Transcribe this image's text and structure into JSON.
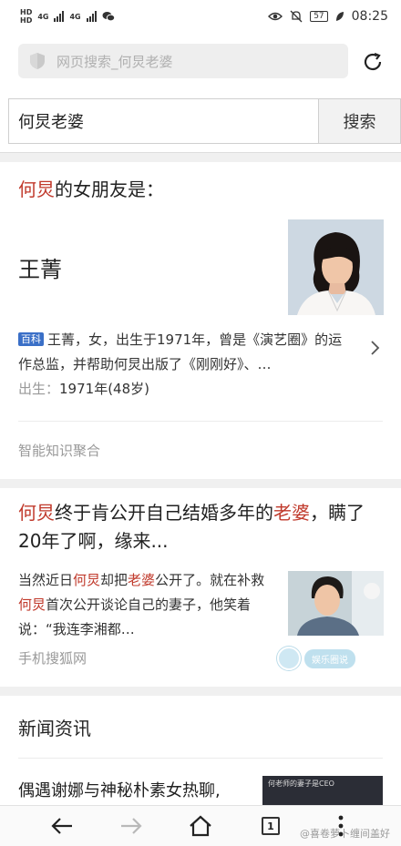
{
  "status_bar": {
    "left_badges": [
      "HD",
      "HD"
    ],
    "network": "4G",
    "battery": "57",
    "time": "08:25"
  },
  "address_bar": {
    "placeholder": "网页搜索_何炅老婆"
  },
  "search": {
    "query": "何炅老婆",
    "button_label": "搜索"
  },
  "knowledge_card": {
    "title_keyword": "何炅",
    "title_rest": "的女朋友是：",
    "name": "王菁",
    "source_tag": "百科",
    "description": "王菁，女，出生于1971年，曾是《演艺圈》的运作总监，并帮助何炅出版了《刚刚好》、…",
    "birth_label": "出生：",
    "birth_value": "1971年(48岁)",
    "footer": "智能知识聚合"
  },
  "article_card": {
    "title_kw1": "何炅",
    "title_part1": "终于肯公开自己结婚多年的",
    "title_kw2": "老婆",
    "title_part2": "，瞒了20年了啊，缘来...",
    "snippet_part1": "当然近日",
    "snippet_kw1": "何炅",
    "snippet_part2": "却把",
    "snippet_kw2": "老婆",
    "snippet_part3": "公开了。就在补救",
    "snippet_kw3": "何炅",
    "snippet_part4": "首次公开谈论自己的妻子，他笑着说：“我连李湘都…",
    "source": "手机搜狐网",
    "watermark": "娱乐圈说"
  },
  "news_card": {
    "title": "新闻资讯",
    "item": "偶遇谢娜与神秘朴素女热聊,",
    "thumb_caption": "何老师的妻子是CEO"
  },
  "bottom_nav": {
    "tab_count": "1",
    "watermark": "@喜卷萝卜缠间盖好"
  },
  "colors": {
    "keyword": "#c0392b",
    "tag": "#3a6fc7"
  }
}
